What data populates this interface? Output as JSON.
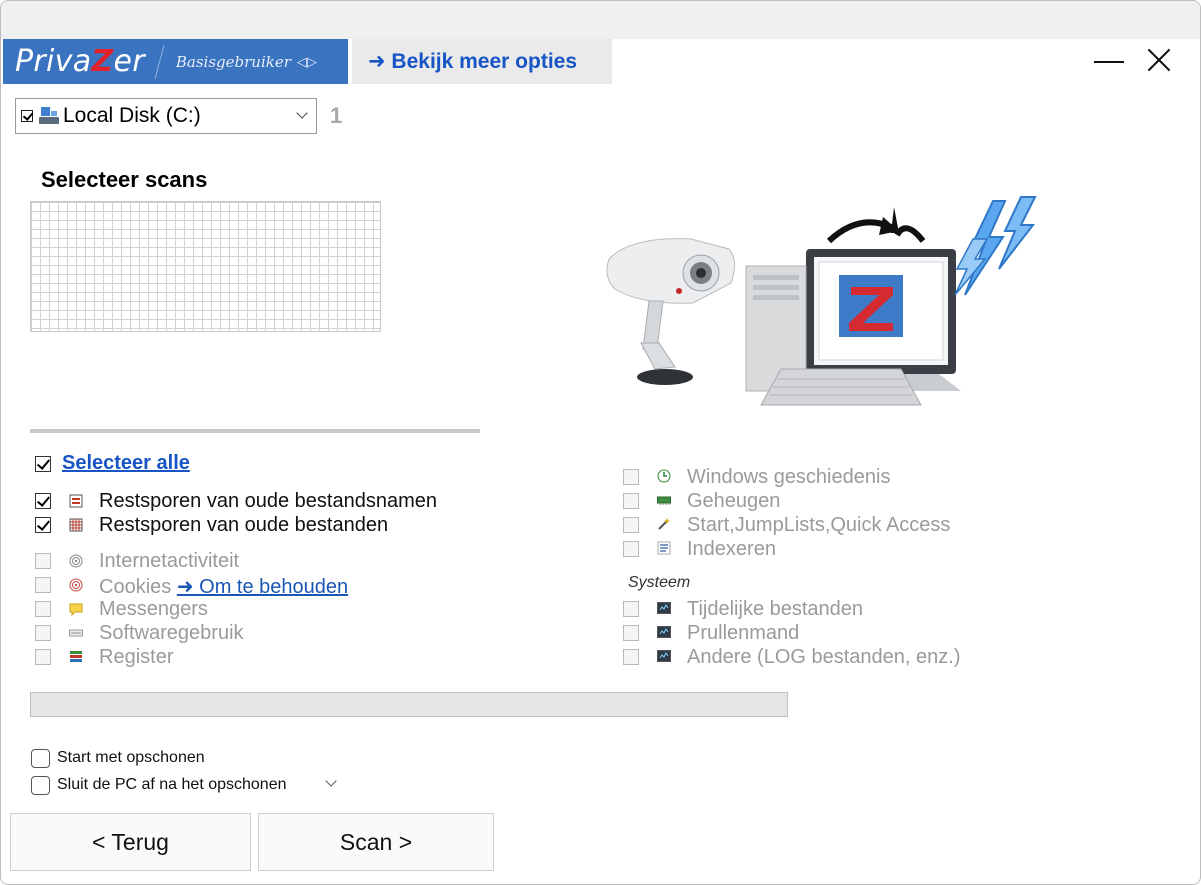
{
  "header": {
    "brand_pre": "Priva",
    "brand_z": "Z",
    "brand_post": "er",
    "mode": "Basisgebruiker",
    "mode_toggle": "◁▷",
    "more_options": "➜ Bekijk meer opties"
  },
  "drive": {
    "label": "Local Disk (C:)",
    "count": "1"
  },
  "scans": {
    "title": "Selecteer scans",
    "select_all": "Selecteer alle",
    "left": [
      {
        "label": "Restsporen van oude bestandsnamen",
        "checked": true,
        "icon": "file-names-icon"
      },
      {
        "label": "Restsporen van oude bestanden",
        "checked": true,
        "icon": "file-grid-icon"
      },
      {
        "label": "Internetactiviteit",
        "checked": false,
        "icon": "fingerprint-icon"
      },
      {
        "label": "Cookies",
        "link": "➜ Om te behouden",
        "checked": false,
        "icon": "cookie-icon"
      },
      {
        "label": "Messengers",
        "checked": false,
        "icon": "chat-bubble-icon"
      },
      {
        "label": "Softwaregebruik",
        "checked": false,
        "icon": "software-bar-icon"
      },
      {
        "label": "Register",
        "checked": false,
        "icon": "registry-icon"
      }
    ],
    "right": [
      {
        "label": "Windows geschiedenis",
        "checked": false,
        "icon": "history-clock-icon"
      },
      {
        "label": "Geheugen",
        "checked": false,
        "icon": "memory-chip-icon"
      },
      {
        "label": "Start,JumpLists,Quick Access",
        "checked": false,
        "icon": "magic-wand-icon"
      },
      {
        "label": "Indexeren",
        "checked": false,
        "icon": "index-list-icon"
      }
    ],
    "system_title": "Systeem",
    "system": [
      {
        "label": "Tijdelijke bestanden",
        "checked": false,
        "icon": "system-window-icon"
      },
      {
        "label": "Prullenmand",
        "checked": false,
        "icon": "system-window-icon"
      },
      {
        "label": "Andere (LOG bestanden, enz.)",
        "checked": false,
        "icon": "system-window-icon"
      }
    ]
  },
  "options": {
    "start_cleaning": "Start met opschonen",
    "shutdown": "Sluit de PC af na het opschonen"
  },
  "buttons": {
    "back": "< Terug",
    "scan": "Scan >"
  },
  "colors": {
    "brand_blue": "#3a73c0",
    "link_blue": "#1755c6",
    "logo_red": "#e2222b"
  }
}
